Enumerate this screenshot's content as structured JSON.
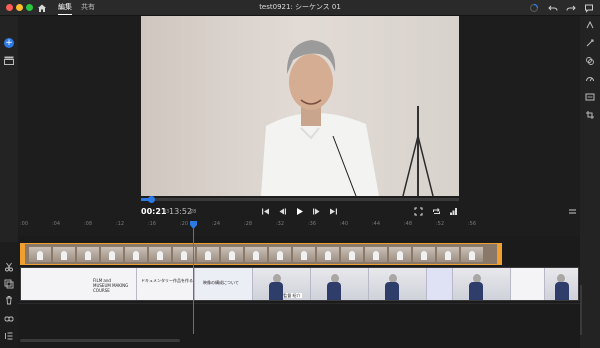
{
  "titlebar": {
    "tabs": [
      "編集",
      "共有"
    ],
    "document_title": "test0921: シーケンス 01"
  },
  "transport": {
    "current_time": "00:21",
    "current_frames": "03",
    "total_time": "13:52",
    "total_frames": "28"
  },
  "ruler": {
    "ticks": [
      ":00",
      ":04",
      ":08",
      ":12",
      ":16",
      ":20",
      ":24",
      ":28",
      ":32",
      ":36",
      ":40",
      ":44",
      ":48",
      ":52",
      ":56"
    ]
  },
  "slides": {
    "title_line1": "FILM and",
    "title_line2": "MUSEUM MAKING",
    "title_line3": "COURSE",
    "slide2_line1": "ドキュメンタリー作品を作る",
    "slide3_line1": "映像の構成について",
    "lower_third": "監 監督 紹介"
  },
  "icons": {
    "home": "home-icon",
    "undo": "undo-icon",
    "redo": "redo-icon",
    "feedback": "comment-icon",
    "status": "progress-ring-icon"
  },
  "colors": {
    "accent": "#2d7ae5",
    "clip_border": "#f0a030",
    "background": "#1d1d1d"
  }
}
